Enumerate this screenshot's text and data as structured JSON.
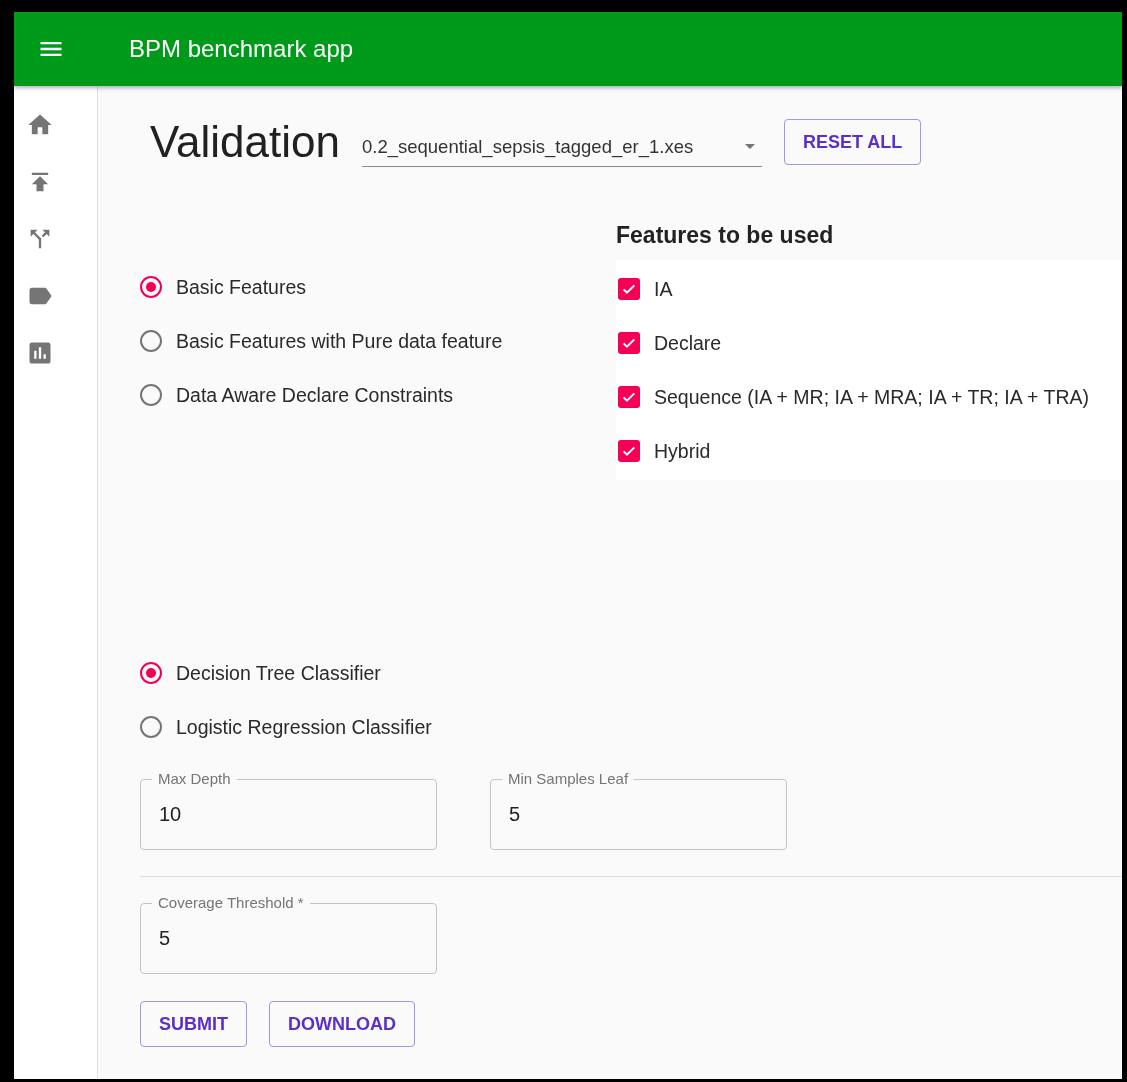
{
  "app_bar": {
    "title": "BPM benchmark app"
  },
  "page": {
    "title": "Validation",
    "file_select": {
      "value": "0.2_sequential_sepsis_tagged_er_1.xes"
    },
    "reset_button": "RESET ALL"
  },
  "feature_set": {
    "options": [
      {
        "label": "Basic Features",
        "selected": true
      },
      {
        "label": "Basic Features with Pure data feature",
        "selected": false
      },
      {
        "label": "Data Aware Declare Constraints",
        "selected": false
      }
    ]
  },
  "features": {
    "title": "Features to be used",
    "items": [
      {
        "label": "IA",
        "checked": true
      },
      {
        "label": "Declare",
        "checked": true
      },
      {
        "label": "Sequence (IA + MR; IA + MRA; IA + TR; IA + TRA)",
        "checked": true
      },
      {
        "label": "Hybrid",
        "checked": true
      }
    ]
  },
  "classifier": {
    "options": [
      {
        "label": "Decision Tree Classifier",
        "selected": true
      },
      {
        "label": "Logistic Regression Classifier",
        "selected": false
      }
    ]
  },
  "params": {
    "fields": [
      {
        "label": "Max Depth",
        "value": "10"
      },
      {
        "label": "Min Samples Leaf",
        "value": "5"
      }
    ]
  },
  "coverage": {
    "label": "Coverage Threshold *",
    "value": "5"
  },
  "buttons": [
    "SUBMIT",
    "DOWNLOAD"
  ]
}
